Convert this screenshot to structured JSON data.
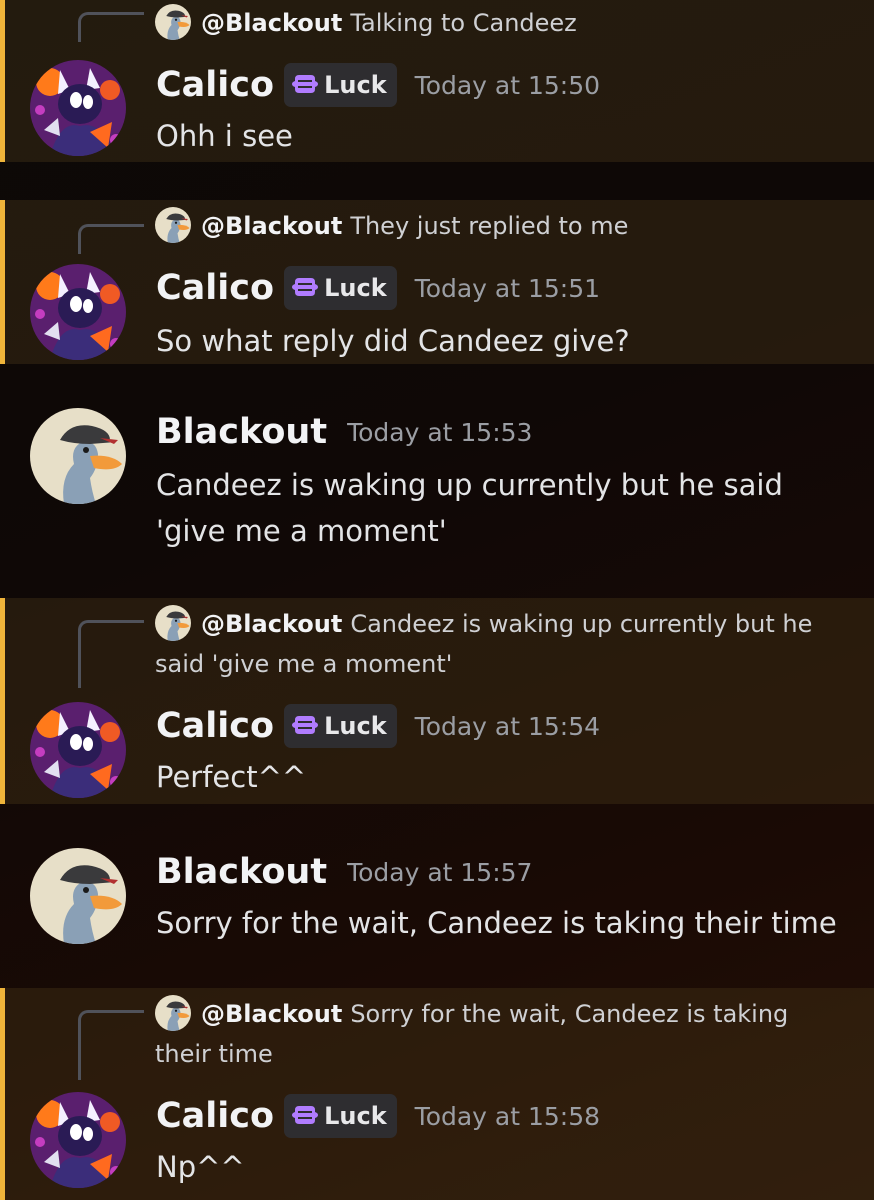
{
  "messages": [
    {
      "author": "Calico",
      "tag": "Luck",
      "time": "Today at 15:50",
      "text": "Ohh i see",
      "reply": {
        "mention": "@Blackout",
        "text": "Talking to Candeez"
      }
    },
    {
      "author": "Calico",
      "tag": "Luck",
      "time": "Today at 15:51",
      "text": "So what reply did Candeez give?",
      "reply": {
        "mention": "@Blackout",
        "text": "They just replied to me"
      }
    },
    {
      "author": "Blackout",
      "time": "Today at 15:53",
      "text_lines": [
        "Candeez is waking up currently but he said",
        "'give me a moment'"
      ]
    },
    {
      "author": "Calico",
      "tag": "Luck",
      "time": "Today at 15:54",
      "text": "Perfect^^",
      "reply": {
        "mention": "@Blackout",
        "text_lines": [
          "Candeez is waking up currently but he",
          "said 'give me a moment'"
        ]
      }
    },
    {
      "author": "Blackout",
      "time": "Today at 15:57",
      "text": "Sorry for the wait, Candeez is taking their time"
    },
    {
      "author": "Calico",
      "tag": "Luck",
      "time": "Today at 15:58",
      "text": "Np^^",
      "reply": {
        "mention": "@Blackout",
        "text_lines": [
          "Sorry for the wait, Candeez is taking",
          "their time"
        ]
      }
    }
  ],
  "colors": {
    "mention_highlight_bar": "#efb43a",
    "mention_background": "#2b2214",
    "tag_icon": "#b07cff",
    "timestamp": "#9b9ea4"
  },
  "icons": {
    "tag_icon": "luck-tag-icon",
    "calico_avatar": "calico-avatar",
    "blackout_avatar": "goose-avatar"
  }
}
